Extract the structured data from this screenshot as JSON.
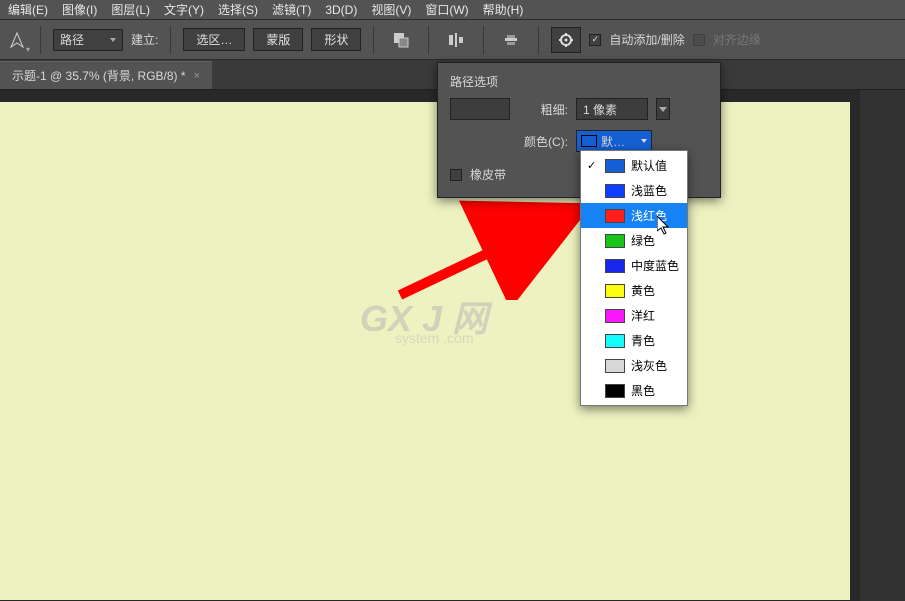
{
  "menu": {
    "edit": "编辑(E)",
    "image": "图像(I)",
    "layer": "图层(L)",
    "type": "文字(Y)",
    "select": "选择(S)",
    "filter": "滤镜(T)",
    "threeD": "3D(D)",
    "view": "视图(V)",
    "window": "窗口(W)",
    "help": "帮助(H)"
  },
  "toolbar": {
    "mode_label": "路径",
    "establish_label": "建立:",
    "selection_btn": "选区…",
    "mask_btn": "蒙版",
    "shape_btn": "形状",
    "auto_add_delete": "自动添加/删除",
    "align_edges": "对齐边缘"
  },
  "tab": {
    "title": "示题-1 @ 35.7% (背景, RGB/8) *"
  },
  "popup": {
    "title": "路径选项",
    "thickness_label": "粗细:",
    "thickness_value": "1 像素",
    "color_label": "颜色(C):",
    "color_value": "默…",
    "rubber_band": "橡皮带"
  },
  "color_options": [
    {
      "label": "默认值",
      "hex": "#155fd4",
      "checked": true
    },
    {
      "label": "浅蓝色",
      "hex": "#0d3dff"
    },
    {
      "label": "浅红色",
      "hex": "#ff1e1e",
      "selected": true
    },
    {
      "label": "绿色",
      "hex": "#17c41a"
    },
    {
      "label": "中度蓝色",
      "hex": "#1926ee"
    },
    {
      "label": "黄色",
      "hex": "#fefc0e"
    },
    {
      "label": "洋红",
      "hex": "#fb17fb"
    },
    {
      "label": "青色",
      "hex": "#17fcfc"
    },
    {
      "label": "浅灰色",
      "hex": "#d7d7d7"
    },
    {
      "label": "黑色",
      "hex": "#000000"
    }
  ],
  "watermark": {
    "main": "GX J 网",
    "sub": "system .com"
  }
}
